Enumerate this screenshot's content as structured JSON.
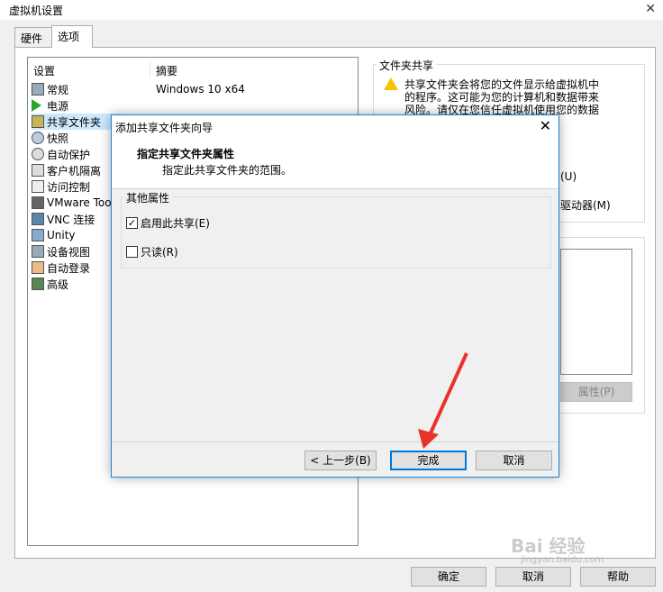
{
  "window": {
    "title": "虚拟机设置"
  },
  "tabs": [
    {
      "label": "硬件"
    },
    {
      "label": "选项"
    }
  ],
  "settings_list": {
    "col_setting": "设置",
    "col_summary": "摘要",
    "summary_value": "Windows 10 x64",
    "items": [
      {
        "label": "常规",
        "icon": "general-icon"
      },
      {
        "label": "电源",
        "icon": "power-icon"
      },
      {
        "label": "共享文件夹",
        "icon": "shared-folder-icon"
      },
      {
        "label": "快照",
        "icon": "snapshot-icon"
      },
      {
        "label": "自动保护",
        "icon": "autoprotect-icon"
      },
      {
        "label": "客户机隔离",
        "icon": "isolation-icon"
      },
      {
        "label": "访问控制",
        "icon": "access-control-icon"
      },
      {
        "label": "VMware Too",
        "icon": "vmware-tools-icon"
      },
      {
        "label": "VNC 连接",
        "icon": "vnc-icon"
      },
      {
        "label": "Unity",
        "icon": "unity-icon"
      },
      {
        "label": "设备视图",
        "icon": "device-view-icon"
      },
      {
        "label": "自动登录",
        "icon": "autologin-icon"
      },
      {
        "label": "高级",
        "icon": "advanced-icon"
      }
    ]
  },
  "shared_folders": {
    "title": "文件夹共享",
    "warning_line1": "共享文件夹会将您的文件显示给虚拟机中",
    "warning_line2": "的程序。这可能为您的计算机和数据带来",
    "warning_line3": "风险。请仅在您信任虚拟机使用您的数据",
    "partial_option_u": "(U)",
    "partial_option_m": "驱动器(M)",
    "properties_button": "属性(P)"
  },
  "dialog": {
    "title": "添加共享文件夹向导",
    "heading": "指定共享文件夹属性",
    "subheading": "指定此共享文件夹的范围。",
    "group_title": "其他属性",
    "enable_share_label": "启用此共享(E)",
    "enable_share_checked": true,
    "readonly_label": "只读(R)",
    "readonly_checked": false,
    "back_button": "< 上一步(B)",
    "finish_button": "完成",
    "cancel_button": "取消"
  },
  "footer": {
    "ok": "确定",
    "cancel": "取消",
    "help": "帮助"
  },
  "watermark": {
    "text": "Bai 经验",
    "url": "jingyan.baidu.com"
  },
  "colors": {
    "accent": "#0078d7",
    "arrow": "#e8332b",
    "warning": "#f5c400"
  }
}
